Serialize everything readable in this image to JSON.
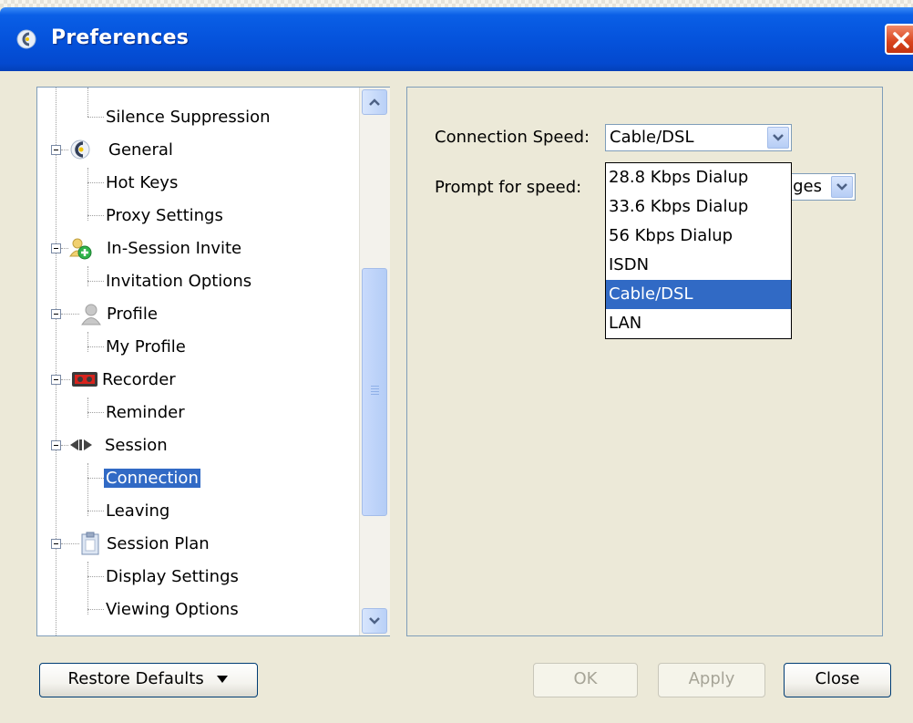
{
  "window": {
    "title": "Preferences"
  },
  "tree": [
    {
      "label": "Silence Suppression",
      "level": "child"
    },
    {
      "label": "General",
      "level": "parent",
      "icon": "general-icon"
    },
    {
      "label": "Hot Keys",
      "level": "child"
    },
    {
      "label": "Proxy Settings",
      "level": "child"
    },
    {
      "label": "In-Session Invite",
      "level": "parent",
      "icon": "invite-icon"
    },
    {
      "label": "Invitation Options",
      "level": "child"
    },
    {
      "label": "Profile",
      "level": "parent",
      "icon": "profile-icon"
    },
    {
      "label": "My Profile",
      "level": "child"
    },
    {
      "label": "Recorder",
      "level": "parent",
      "icon": "recorder-icon"
    },
    {
      "label": "Reminder",
      "level": "child"
    },
    {
      "label": "Session",
      "level": "parent",
      "icon": "session-icon"
    },
    {
      "label": "Connection",
      "level": "child",
      "selected": true
    },
    {
      "label": "Leaving",
      "level": "child"
    },
    {
      "label": "Session Plan",
      "level": "parent",
      "icon": "clipboard-icon"
    },
    {
      "label": "Display Settings",
      "level": "child"
    },
    {
      "label": "Viewing Options",
      "level": "child"
    }
  ],
  "connection": {
    "speed_label": "Connection Speed:",
    "speed_value": "Cable/DSL",
    "prompt_label": "Prompt for speed:",
    "prompt_value_partial": "ges",
    "options": [
      "28.8 Kbps Dialup",
      "33.6 Kbps Dialup",
      "56 Kbps Dialup",
      "ISDN",
      "Cable/DSL",
      "LAN"
    ],
    "selected_option": "Cable/DSL"
  },
  "buttons": {
    "restore_defaults": "Restore Defaults",
    "ok": "OK",
    "apply": "Apply",
    "close": "Close"
  },
  "colors": {
    "titlebar": "#0553dc",
    "selection": "#316ac5",
    "dialog_bg": "#ece9d8"
  }
}
